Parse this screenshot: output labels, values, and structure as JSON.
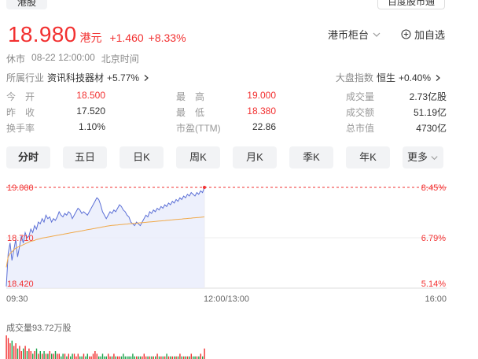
{
  "tabs": {
    "hk": "港股",
    "baidu": "百度股市通"
  },
  "quote": {
    "price": "18.980",
    "currency": "港元",
    "change": "+1.460",
    "change_pct": "+8.33%",
    "exchange_label": "港币柜台",
    "watch_label": "加自选"
  },
  "status": {
    "state": "休市",
    "datetime": "08-22 12:00:00",
    "timezone": "北京时间"
  },
  "industry": {
    "label": "所属行业",
    "name": "资讯科技器材",
    "change": "+5.77%"
  },
  "index": {
    "label": "大盘指数",
    "name": "恒生",
    "change": "+0.40%"
  },
  "stats": [
    [
      {
        "label": "今　开",
        "value": "18.500",
        "red": true
      },
      {
        "label": "最　高",
        "value": "19.000",
        "red": true
      },
      {
        "label": "成交量",
        "value": "2.73亿股",
        "red": false
      }
    ],
    [
      {
        "label": "昨　收",
        "value": "17.520",
        "red": false
      },
      {
        "label": "最　低",
        "value": "18.380",
        "red": true
      },
      {
        "label": "成交额",
        "value": "51.19亿",
        "red": false
      }
    ],
    [
      {
        "label": "换手率",
        "value": "1.10%",
        "red": false
      },
      {
        "label": "市盈(TTM)",
        "value": "22.86",
        "red": false
      },
      {
        "label": "总市值",
        "value": "4730亿",
        "red": false
      }
    ]
  ],
  "periods": [
    "分时",
    "五日",
    "日K",
    "周K",
    "月K",
    "季K",
    "年K"
  ],
  "more_label": "更多",
  "chart_data": {
    "type": "line",
    "y_left_ticks": [
      "19.000",
      "18.710",
      "18.420"
    ],
    "y_right_ticks": [
      "8.45%",
      "6.79%",
      "5.14%"
    ],
    "x_ticks": [
      "09:30",
      "12:00/13:00",
      "16:00"
    ],
    "ylim": [
      18.42,
      19.0
    ],
    "volume_label": "成交量93.72万股",
    "colors": {
      "price": "#5b6fd6",
      "avg": "#f0a94a",
      "up": "#f23030",
      "down": "#1aa34a",
      "fill": "#e8ecfb"
    },
    "price_series": [
      18.43,
      18.62,
      18.68,
      18.58,
      18.64,
      18.7,
      18.6,
      18.66,
      18.72,
      18.68,
      18.74,
      18.71,
      18.72,
      18.76,
      18.74,
      18.78,
      18.76,
      18.8,
      18.79,
      18.82,
      18.8,
      18.84,
      18.82,
      18.83,
      18.8,
      18.82,
      18.81,
      18.83,
      18.86,
      18.84,
      18.83,
      18.85,
      18.84,
      18.86,
      18.85,
      18.82,
      18.84,
      18.86,
      18.88,
      18.87,
      18.85,
      18.86,
      18.85,
      18.84,
      18.86,
      18.88,
      18.9,
      18.92,
      18.94,
      18.93,
      18.9,
      18.86,
      18.84,
      18.82,
      18.84,
      18.86,
      18.85,
      18.87,
      18.86,
      18.88,
      18.9,
      18.89,
      18.87,
      18.86,
      18.84,
      18.83,
      18.8,
      18.79,
      18.78,
      18.8,
      18.79,
      18.78,
      18.8,
      18.82,
      18.84,
      18.83,
      18.86,
      18.85,
      18.87,
      18.86,
      18.88,
      18.87,
      18.89,
      18.88,
      18.9,
      18.89,
      18.91,
      18.9,
      18.92,
      18.91,
      18.93,
      18.92,
      18.94,
      18.93,
      18.95,
      18.94,
      18.96,
      18.95,
      18.97,
      18.96,
      18.95,
      18.97,
      18.96,
      18.98,
      18.97,
      19.0
    ],
    "avg_series": [
      18.54,
      18.6,
      18.62,
      18.63,
      18.64,
      18.65,
      18.655,
      18.66,
      18.665,
      18.67,
      18.675,
      18.68,
      18.685,
      18.69,
      18.692,
      18.695,
      18.7,
      18.702,
      18.705,
      18.708,
      18.71,
      18.712,
      18.714,
      18.716,
      18.718,
      18.72,
      18.722,
      18.724,
      18.726,
      18.728,
      18.73,
      18.732,
      18.734,
      18.736,
      18.738,
      18.74,
      18.742,
      18.744,
      18.746,
      18.748,
      18.75,
      18.752,
      18.754,
      18.756,
      18.758,
      18.76,
      18.762,
      18.764,
      18.766,
      18.768,
      18.77,
      18.772,
      18.774,
      18.776,
      18.778,
      18.78,
      18.781,
      18.782,
      18.783,
      18.784,
      18.785,
      18.786,
      18.787,
      18.788,
      18.789,
      18.79,
      18.791,
      18.792,
      18.793,
      18.794,
      18.795,
      18.796,
      18.797,
      18.798,
      18.799,
      18.8,
      18.801,
      18.802,
      18.803,
      18.804,
      18.805,
      18.806,
      18.807,
      18.808,
      18.809,
      18.81,
      18.811,
      18.812,
      18.813,
      18.814,
      18.815,
      18.816,
      18.817,
      18.818,
      18.819,
      18.82,
      18.821,
      18.822,
      18.823,
      18.824,
      18.825,
      18.826,
      18.827,
      18.828,
      18.829,
      18.83
    ],
    "volume_series": [
      9,
      8,
      6,
      7,
      5,
      6,
      4,
      5,
      3,
      4,
      5,
      3,
      4,
      3,
      2,
      3,
      4,
      2,
      3,
      2,
      3,
      2,
      2,
      3,
      2,
      2,
      3,
      2,
      2,
      1,
      2,
      2,
      1,
      2,
      1,
      2,
      2,
      1,
      2,
      1,
      1,
      2,
      1,
      2,
      1,
      1,
      2,
      3,
      2,
      1,
      1,
      2,
      1,
      1,
      2,
      1,
      1,
      2,
      1,
      1,
      1,
      1,
      2,
      1,
      1,
      1,
      1,
      2,
      1,
      1,
      1,
      1,
      1,
      2,
      1,
      1,
      1,
      1,
      1,
      1,
      2,
      1,
      1,
      1,
      1,
      2,
      1,
      1,
      1,
      1,
      1,
      1,
      2,
      1,
      1,
      1,
      1,
      1,
      2,
      1,
      1,
      1,
      1,
      2,
      1,
      4
    ]
  }
}
